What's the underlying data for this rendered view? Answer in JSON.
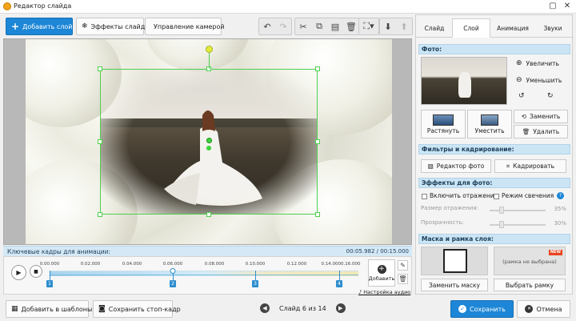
{
  "window": {
    "title": "Редактор слайда",
    "minimize": "▢",
    "close": "✕"
  },
  "toolbar": {
    "add_layer": "Добавить слой",
    "slide_effects": "Эффекты слайда",
    "camera_control": "Управление камерой"
  },
  "keyframes": {
    "header": "Ключевые кадры для анимации:",
    "time": "00:05.982 / 00:15.000",
    "ticks": [
      "0.00.000",
      "0.02.000",
      "0.04.000",
      "0.06.000",
      "0.08.000",
      "0.10.000",
      "0.12.000",
      "0.14.0000.16.000"
    ],
    "markers": [
      "1",
      "2",
      "3",
      "4"
    ],
    "add_label": "Добавить",
    "audio_link": "Настройка аудио"
  },
  "bottom": {
    "add_to_templates": "Добавить в шаблоны",
    "save_frame": "Сохранить стоп-кадр",
    "slide_counter": "Слайд 6 из 14",
    "save": "Сохранить",
    "cancel": "Отмена"
  },
  "panel": {
    "tabs": [
      "Слайд",
      "Слой",
      "Анимация",
      "Звуки"
    ],
    "active_tab": "Слой",
    "photo_section": "Фото:",
    "zoom_in": "Увеличить",
    "zoom_out": "Уменьшить",
    "stretch": "Растянуть",
    "fit": "Уместить",
    "replace": "Заменить",
    "delete": "Удалить",
    "filters_section": "Фильтры и кадрирование:",
    "photo_editor": "Редактор фото",
    "crop": "Кадрировать",
    "effects_section": "Эффекты для фото:",
    "reflection": "Включить отражение",
    "glow": "Режим свечения",
    "reflection_size": "Размер отражения:",
    "reflection_size_value": "35%",
    "transparency": "Прозрачность:",
    "transparency_value": "30%",
    "mask_section": "Маска и рамка слоя:",
    "frame_placeholder": "(рамка не выбрана)",
    "new_badge": "NEW",
    "change_mask": "Заменить маску",
    "choose_frame": "Выбрать рамку"
  },
  "colors": {
    "accent": "#1d86d6",
    "selection": "#4fcf4f",
    "keyframe": "#2e8ecf",
    "section_bg": "#cbe5f5"
  }
}
